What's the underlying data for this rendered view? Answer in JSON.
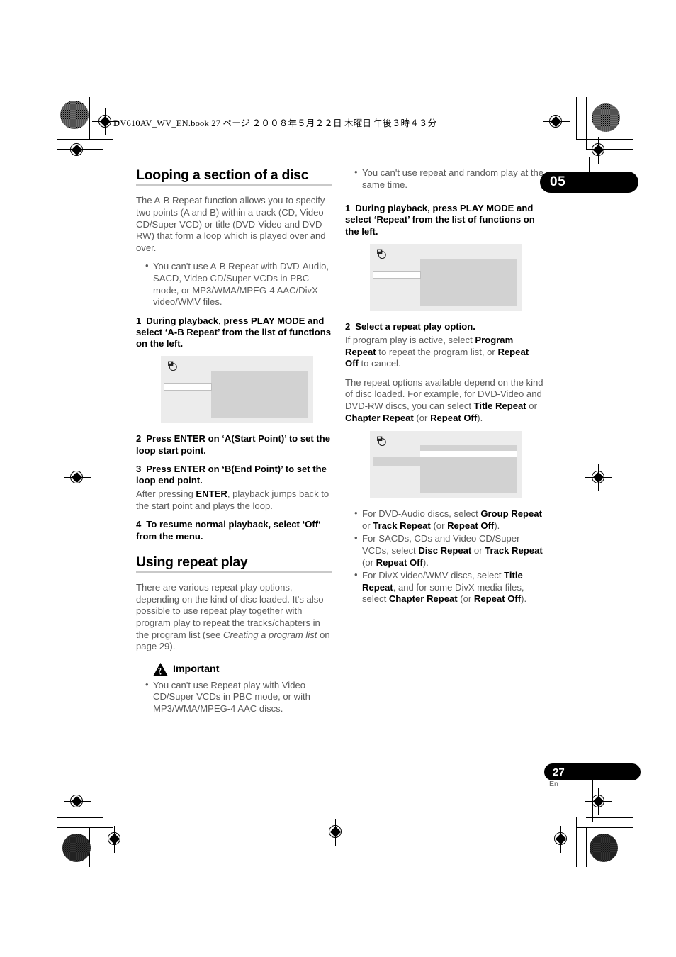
{
  "print": {
    "book_line": "DV610AV_WV_EN.book   27 ページ   ２００８年５月２２日   木曜日   午後３時４３分"
  },
  "chapter": {
    "number": "05"
  },
  "footer": {
    "page_number": "27",
    "language": "En"
  },
  "left_column": {
    "heading": "Looping a section of a disc",
    "intro": "The A-B Repeat function allows you to specify two points (A and B) within a track (CD, Video CD/Super VCD) or title (DVD-Video and DVD-RW) that form a loop which is played over and over.",
    "intro_bullets": [
      "You can't use A-B Repeat with DVD-Audio, SACD, Video CD/Super VCDs in PBC mode, or MP3/WMA/MPEG-4 AAC/DivX video/WMV files."
    ],
    "step1_num": "1",
    "step1": "During playback, press PLAY MODE and select ‘A-B Repeat’ from the list of functions on the left.",
    "osd1_icon": "disc-osd-icon",
    "step2_num": "2",
    "step2": "Press ENTER on ‘A(Start Point)’ to set the loop start point.",
    "step3_num": "3",
    "step3": "Press ENTER on ‘B(End Point)’ to set the loop end point.",
    "step3_body_pre": "After pressing ",
    "step3_body_bold": "ENTER",
    "step3_body_post": ", playback jumps back to the start point and plays the loop.",
    "step4_num": "4",
    "step4": "To resume normal playback, select ‘Off‘ from the menu.",
    "heading2": "Using repeat play",
    "repeat_intro_pre": "There are various repeat play options, depending on the kind of disc loaded. It's also possible to use repeat play together with program play to repeat the tracks/chapters in the program list (see ",
    "repeat_intro_italic": "Creating a program list",
    "repeat_intro_post": " on page 29).",
    "important_label": "Important",
    "important_icon": "warning-hand-icon",
    "important_bullets": [
      "You can't use Repeat play with Video CD/Super VCDs in PBC mode, or with MP3/WMA/MPEG-4 AAC discs."
    ]
  },
  "right_column": {
    "top_bullets": [
      "You can't use repeat and random play at the same time."
    ],
    "step1_num": "1",
    "step1": "During playback, press PLAY MODE and select ‘Repeat’ from the list of functions on the left.",
    "osd2_icon": "disc-osd-icon",
    "step2_num": "2",
    "step2": "Select a repeat play option.",
    "step2_body": [
      {
        "t": "If program play is active, select ",
        "b": false
      },
      {
        "t": "Program Repeat",
        "b": true
      },
      {
        "t": " to repeat the program list, or ",
        "b": false
      },
      {
        "t": "Repeat Off",
        "b": true
      },
      {
        "t": " to cancel.",
        "b": false
      }
    ],
    "step2_body2": [
      {
        "t": "The repeat options available depend on the kind of disc loaded. For example, for DVD-Video and DVD-RW discs, you can select ",
        "b": false
      },
      {
        "t": "Title Repeat",
        "b": true
      },
      {
        "t": " or ",
        "b": false
      },
      {
        "t": "Chapter Repeat",
        "b": true
      },
      {
        "t": " (or ",
        "b": false
      },
      {
        "t": "Repeat Off",
        "b": true
      },
      {
        "t": ").",
        "b": false
      }
    ],
    "osd3_icon": "disc-osd-icon",
    "bottom_bullets": [
      [
        {
          "t": "For DVD-Audio discs, select ",
          "b": false
        },
        {
          "t": "Group Repeat",
          "b": true
        },
        {
          "t": " or ",
          "b": false
        },
        {
          "t": "Track Repeat",
          "b": true
        },
        {
          "t": " (or ",
          "b": false
        },
        {
          "t": "Repeat Off",
          "b": true
        },
        {
          "t": ").",
          "b": false
        }
      ],
      [
        {
          "t": "For SACDs, CDs and Video CD/Super VCDs, select ",
          "b": false
        },
        {
          "t": "Disc Repeat",
          "b": true
        },
        {
          "t": " or ",
          "b": false
        },
        {
          "t": "Track Repeat",
          "b": true
        },
        {
          "t": " (or ",
          "b": false
        },
        {
          "t": "Repeat Off",
          "b": true
        },
        {
          "t": ").",
          "b": false
        }
      ],
      [
        {
          "t": "For DivX video/WMV discs, select ",
          "b": false
        },
        {
          "t": "Title Repeat",
          "b": true
        },
        {
          "t": ", and for some DivX media files, select ",
          "b": false
        },
        {
          "t": "Chapter Repeat",
          "b": true
        },
        {
          "t": " (or ",
          "b": false
        },
        {
          "t": "Repeat Off",
          "b": true
        },
        {
          "t": ").",
          "b": false
        }
      ]
    ]
  },
  "colors": {
    "body_text": "#595959",
    "heading_text": "#000000",
    "rule": "#c9c9c9",
    "osd_background": "#ececec",
    "osd_panel": "#d2d2d2",
    "tab_background": "#000000"
  }
}
